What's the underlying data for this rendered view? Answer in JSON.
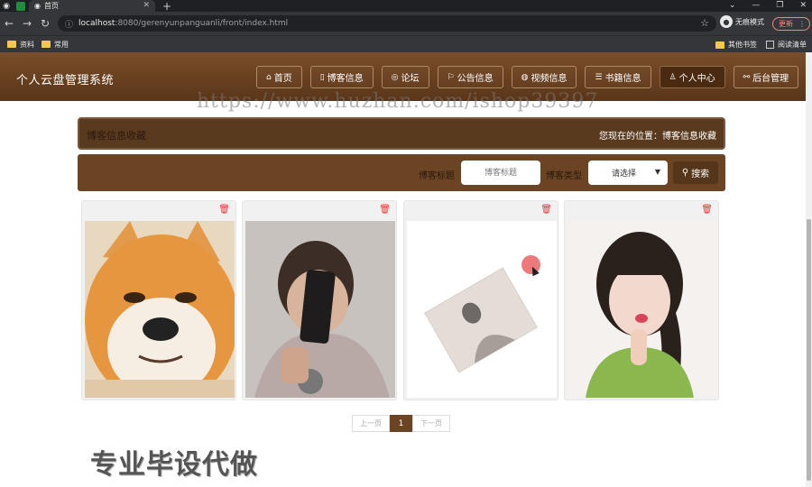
{
  "browser": {
    "active_tab_title": "首页",
    "url_host": "localhost",
    "url_path": ":8080/gerenyunpanguanli/front/index.html",
    "incognito_label": "无痕模式",
    "update_label": "更新",
    "bookmarks": [
      "资料",
      "常用"
    ],
    "bookmarks_right": [
      "其他书签",
      "阅读清单"
    ]
  },
  "site": {
    "title": "个人云盘管理系统",
    "nav": [
      {
        "icon": "⌂",
        "label": "首页"
      },
      {
        "icon": "▯",
        "label": "博客信息"
      },
      {
        "icon": "◎",
        "label": "论坛"
      },
      {
        "icon": "⚐",
        "label": "公告信息"
      },
      {
        "icon": "◍",
        "label": "视频信息"
      },
      {
        "icon": "☰",
        "label": "书籍信息"
      },
      {
        "icon": "♙",
        "label": "个人中心"
      },
      {
        "icon": "⚯",
        "label": "后台管理"
      }
    ]
  },
  "watermark": "https://www.huzhan.com/ishop39397",
  "page": {
    "title": "博客信息收藏",
    "breadcrumb": "您现在的位置：博客信息收藏"
  },
  "search": {
    "title_label": "博客标题",
    "title_placeholder": "博客标题",
    "type_label": "博客类型",
    "type_selected": "请选择",
    "button_label": "搜索"
  },
  "pagination": {
    "prev": "上一页",
    "current": "1",
    "next": "下一页"
  },
  "promo": "专业毕设代做",
  "colors": {
    "header_brown": "#6b4423",
    "delete_red": "#e33333"
  }
}
